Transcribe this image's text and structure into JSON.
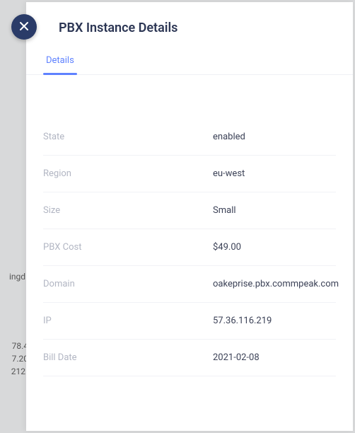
{
  "background_hints": {
    "a": "ingd",
    "b": "78.4",
    "c": "7.20",
    "d": "212"
  },
  "header": {
    "title": "PBX Instance Details"
  },
  "tabs": [
    {
      "label": "Details",
      "active": true
    }
  ],
  "details": [
    {
      "label": "State",
      "value": "enabled"
    },
    {
      "label": "Region",
      "value": "eu-west"
    },
    {
      "label": "Size",
      "value": "Small"
    },
    {
      "label": "PBX Cost",
      "value": "$49.00"
    },
    {
      "label": "Domain",
      "value": "oakeprise.pbx.commpeak.com"
    },
    {
      "label": "IP",
      "value": "57.36.116.219"
    },
    {
      "label": "Bill Date",
      "value": "2021-02-08"
    }
  ]
}
